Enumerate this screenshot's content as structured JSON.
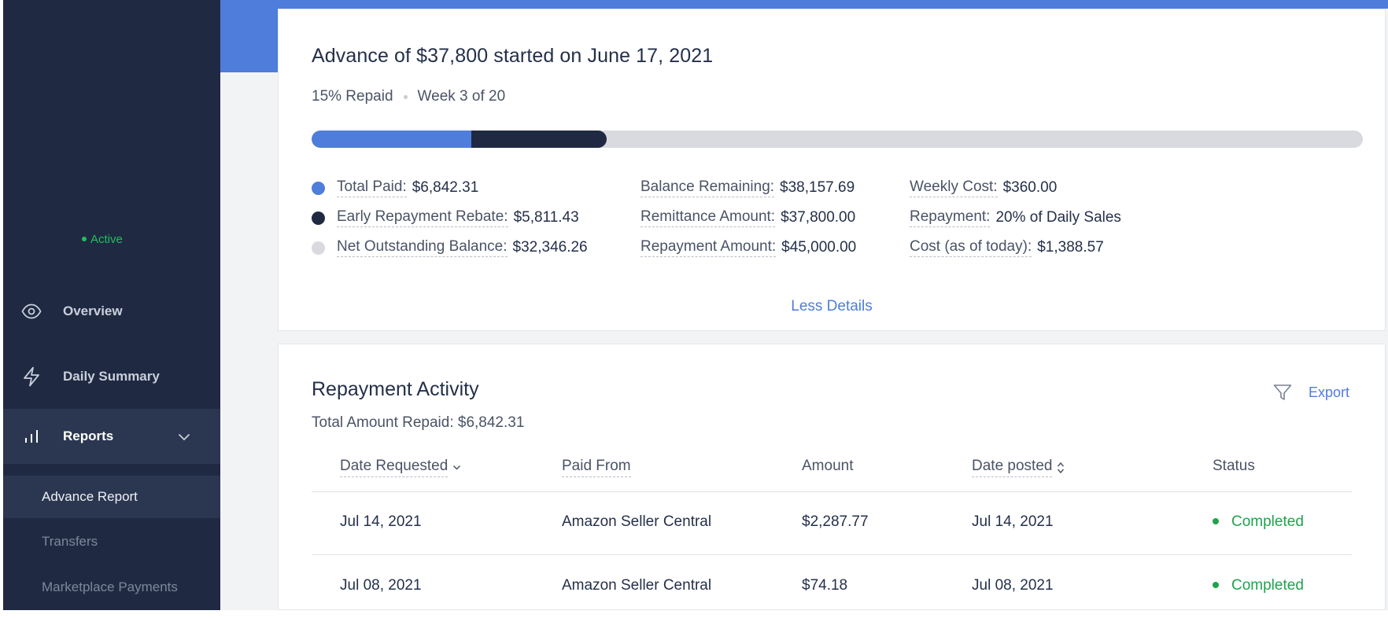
{
  "sidebar": {
    "status_label": "Active",
    "nav": [
      {
        "label": "Overview",
        "icon": "eye-icon"
      },
      {
        "label": "Daily Summary",
        "icon": "lightning-icon"
      },
      {
        "label": "Reports",
        "icon": "bar-chart-icon"
      }
    ],
    "reports_sub": [
      {
        "label": "Advance Report",
        "active": true
      },
      {
        "label": "Transfers",
        "active": false
      },
      {
        "label": "Marketplace Payments",
        "active": false
      }
    ]
  },
  "advance": {
    "title": "Advance of $37,800 started on June 17, 2021",
    "repaid_text": "15% Repaid",
    "week_text": "Week 3 of 20",
    "progress": {
      "paid_fraction": 0.152,
      "rebate_fraction": 0.129
    },
    "col1": [
      {
        "label": "Total Paid:",
        "value": "$6,842.31",
        "color": "#4e7ddb"
      },
      {
        "label": "Early Repayment Rebate:",
        "value": "$5,811.43",
        "color": "#1f2a42"
      },
      {
        "label": "Net Outstanding Balance:",
        "value": "$32,346.26",
        "color": "#d9dadf"
      }
    ],
    "col2": [
      {
        "label": "Balance Remaining:",
        "value": "$38,157.69"
      },
      {
        "label": "Remittance Amount:",
        "value": "$37,800.00"
      },
      {
        "label": "Repayment Amount:",
        "value": "$45,000.00"
      }
    ],
    "col3": [
      {
        "label": "Weekly Cost:",
        "value": "$360.00"
      },
      {
        "label": "Repayment:",
        "value": "20% of Daily Sales"
      },
      {
        "label": "Cost (as of today):",
        "value": "$1,388.57"
      }
    ],
    "less_details": "Less Details"
  },
  "activity": {
    "title": "Repayment Activity",
    "total_text": "Total Amount Repaid: $6,842.31",
    "export_label": "Export",
    "columns": [
      "Date Requested",
      "Paid From",
      "Amount",
      "Date posted",
      "Status"
    ],
    "rows": [
      {
        "date_requested": "Jul 14, 2021",
        "paid_from": "Amazon Seller Central",
        "amount": "$2,287.77",
        "date_posted": "Jul 14, 2021",
        "status": "Completed"
      },
      {
        "date_requested": "Jul 08, 2021",
        "paid_from": "Amazon Seller Central",
        "amount": "$74.18",
        "date_posted": "Jul 08, 2021",
        "status": "Completed"
      }
    ]
  },
  "colors": {
    "accent": "#4e7ddb",
    "sidebar_bg": "#1f2a42",
    "success": "#1fa34e"
  }
}
